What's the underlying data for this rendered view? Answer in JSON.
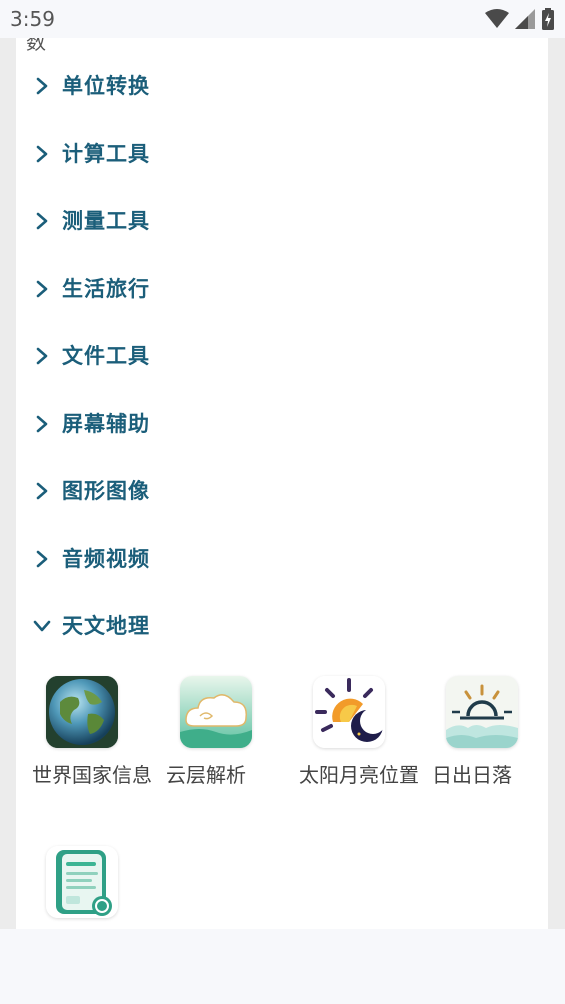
{
  "status": {
    "time": "3:59"
  },
  "partial_text": "数",
  "categories": [
    {
      "label": "单位转换",
      "expanded": false
    },
    {
      "label": "计算工具",
      "expanded": false
    },
    {
      "label": "测量工具",
      "expanded": false
    },
    {
      "label": "生活旅行",
      "expanded": false
    },
    {
      "label": "文件工具",
      "expanded": false
    },
    {
      "label": "屏幕辅助",
      "expanded": false
    },
    {
      "label": "图形图像",
      "expanded": false
    },
    {
      "label": "音频视频",
      "expanded": false
    },
    {
      "label": "天文地理",
      "expanded": true
    }
  ],
  "apps": [
    {
      "name": "世界国家信息",
      "icon": "globe-icon"
    },
    {
      "name": "云层解析",
      "icon": "cloud-icon"
    },
    {
      "name": "太阳月亮位置",
      "icon": "sun-moon-icon"
    },
    {
      "name": "日出日落",
      "icon": "sunrise-icon"
    },
    {
      "name": "",
      "icon": "document-icon"
    }
  ],
  "colors": {
    "accent": "#1b5e7a",
    "chevron": "#1b5e7a"
  }
}
